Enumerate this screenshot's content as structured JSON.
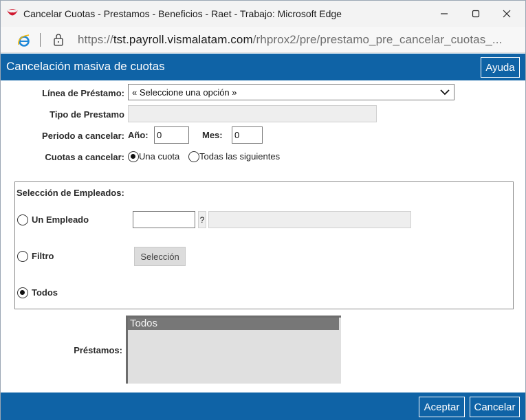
{
  "window": {
    "title": "Cancelar Cuotas - Prestamos - Beneficios - Raet - Trabajo: Microsoft Edge"
  },
  "address": {
    "protocol": "https://",
    "host": "tst.payroll.vismalatam.com",
    "path": "/rhprox2/pre/prestamo_pre_cancelar_cuotas_..."
  },
  "header": {
    "title": "Cancelación masiva de cuotas",
    "help_label": "Ayuda"
  },
  "form": {
    "linea_label": "Línea de Préstamo:",
    "linea_value": "« Seleccione una opción »",
    "tipo_label": "Tipo de Prestamo",
    "tipo_value": "",
    "periodo_label": "Periodo a cancelar:",
    "anio_label": "Año:",
    "anio_value": "0",
    "mes_label": "Mes:",
    "mes_value": "0",
    "cuotas_label": "Cuotas a cancelar:",
    "cuota_una": "Una cuota",
    "cuota_todas": "Todas las siguientes",
    "cuota_selected": "una"
  },
  "empleados": {
    "legend": "Selección de Empleados:",
    "un_empleado_label": "Un Empleado",
    "empleado_code": "",
    "empleado_name": "",
    "lookup_label": "?",
    "filtro_label": "Filtro",
    "seleccion_label": "Selección",
    "todos_label": "Todos",
    "selected": "todos"
  },
  "prestamos": {
    "label": "Préstamos:",
    "items": [
      "Todos"
    ]
  },
  "footer": {
    "ok_label": "Aceptar",
    "cancel_label": "Cancelar"
  },
  "colors": {
    "accent": "#0f63a6"
  }
}
